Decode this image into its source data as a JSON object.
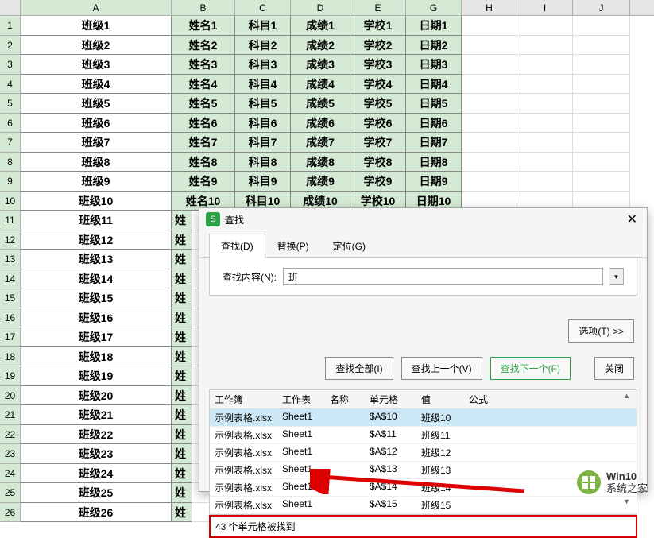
{
  "columns": [
    "A",
    "B",
    "C",
    "D",
    "E",
    "G",
    "H",
    "I",
    "J"
  ],
  "rows": [
    {
      "n": "1",
      "A": "班级1",
      "B": "姓名1",
      "C": "科目1",
      "D": "成绩1",
      "E": "学校1",
      "G": "日期1"
    },
    {
      "n": "2",
      "A": "班级2",
      "B": "姓名2",
      "C": "科目2",
      "D": "成绩2",
      "E": "学校2",
      "G": "日期2"
    },
    {
      "n": "3",
      "A": "班级3",
      "B": "姓名3",
      "C": "科目3",
      "D": "成绩3",
      "E": "学校3",
      "G": "日期3"
    },
    {
      "n": "4",
      "A": "班级4",
      "B": "姓名4",
      "C": "科目4",
      "D": "成绩4",
      "E": "学校4",
      "G": "日期4"
    },
    {
      "n": "5",
      "A": "班级5",
      "B": "姓名5",
      "C": "科目5",
      "D": "成绩5",
      "E": "学校5",
      "G": "日期5"
    },
    {
      "n": "6",
      "A": "班级6",
      "B": "姓名6",
      "C": "科目6",
      "D": "成绩6",
      "E": "学校6",
      "G": "日期6"
    },
    {
      "n": "7",
      "A": "班级7",
      "B": "姓名7",
      "C": "科目7",
      "D": "成绩7",
      "E": "学校7",
      "G": "日期7"
    },
    {
      "n": "8",
      "A": "班级8",
      "B": "姓名8",
      "C": "科目8",
      "D": "成绩8",
      "E": "学校8",
      "G": "日期8"
    },
    {
      "n": "9",
      "A": "班级9",
      "B": "姓名9",
      "C": "科目9",
      "D": "成绩9",
      "E": "学校9",
      "G": "日期9"
    },
    {
      "n": "10",
      "A": "班级10",
      "B": "姓名10",
      "C": "科目10",
      "D": "成绩10",
      "E": "学校10",
      "G": "日期10"
    },
    {
      "n": "11",
      "A": "班级11",
      "B": "姓"
    },
    {
      "n": "12",
      "A": "班级12",
      "B": "姓"
    },
    {
      "n": "13",
      "A": "班级13",
      "B": "姓"
    },
    {
      "n": "14",
      "A": "班级14",
      "B": "姓"
    },
    {
      "n": "15",
      "A": "班级15",
      "B": "姓"
    },
    {
      "n": "16",
      "A": "班级16",
      "B": "姓"
    },
    {
      "n": "17",
      "A": "班级17",
      "B": "姓"
    },
    {
      "n": "18",
      "A": "班级18",
      "B": "姓"
    },
    {
      "n": "19",
      "A": "班级19",
      "B": "姓"
    },
    {
      "n": "20",
      "A": "班级20",
      "B": "姓"
    },
    {
      "n": "21",
      "A": "班级21",
      "B": "姓"
    },
    {
      "n": "22",
      "A": "班级22",
      "B": "姓"
    },
    {
      "n": "23",
      "A": "班级23",
      "B": "姓"
    },
    {
      "n": "24",
      "A": "班级24",
      "B": "姓"
    },
    {
      "n": "25",
      "A": "班级25",
      "B": "姓"
    },
    {
      "n": "26",
      "A": "班级26",
      "B": "姓"
    }
  ],
  "dialog": {
    "title": "查找",
    "tabs": {
      "find": "查找(D)",
      "replace": "替换(P)",
      "goto": "定位(G)"
    },
    "search_label": "查找内容(N):",
    "search_value": "班",
    "options_btn": "选项(T) >>",
    "find_all_btn": "查找全部(I)",
    "find_prev_btn": "查找上一个(V)",
    "find_next_btn": "查找下一个(F)",
    "close_btn": "关闭",
    "results_header": {
      "workbook": "工作簿",
      "sheet": "工作表",
      "name": "名称",
      "cell": "单元格",
      "value": "值",
      "formula": "公式"
    },
    "results": [
      {
        "workbook": "示例表格.xlsx",
        "sheet": "Sheet1",
        "name": "",
        "cell": "$A$10",
        "value": "班级10",
        "formula": "",
        "selected": true
      },
      {
        "workbook": "示例表格.xlsx",
        "sheet": "Sheet1",
        "name": "",
        "cell": "$A$11",
        "value": "班级11",
        "formula": ""
      },
      {
        "workbook": "示例表格.xlsx",
        "sheet": "Sheet1",
        "name": "",
        "cell": "$A$12",
        "value": "班级12",
        "formula": ""
      },
      {
        "workbook": "示例表格.xlsx",
        "sheet": "Sheet1",
        "name": "",
        "cell": "$A$13",
        "value": "班级13",
        "formula": ""
      },
      {
        "workbook": "示例表格.xlsx",
        "sheet": "Sheet1",
        "name": "",
        "cell": "$A$14",
        "value": "班级14",
        "formula": ""
      },
      {
        "workbook": "示例表格.xlsx",
        "sheet": "Sheet1",
        "name": "",
        "cell": "$A$15",
        "value": "班级15",
        "formula": ""
      }
    ],
    "status": "43 个单元格被找到"
  },
  "watermark": {
    "brand": "Win10",
    "sub": "系统之家"
  }
}
